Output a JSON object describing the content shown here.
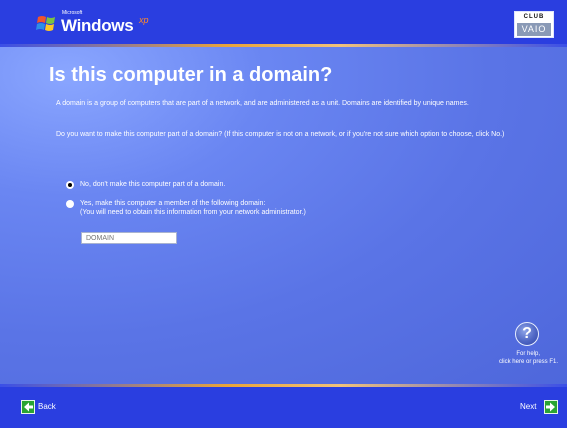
{
  "header": {
    "logo_small": "Microsoft",
    "logo_word": "Windows",
    "logo_xp": "xp",
    "club_top": "CLUB",
    "club_bottom": "VAIO"
  },
  "page": {
    "title": "Is this computer in a domain?",
    "paragraph1": "A domain is a group of computers that are part of a network, and are administered as a unit. Domains are identified by unique names.",
    "paragraph2": "Do you want to make this computer part of a domain? (If this computer is not on a network, or if you're not sure which option to choose, click No.)"
  },
  "options": {
    "no": {
      "label": "No, don't make this computer part of a domain.",
      "selected": true
    },
    "yes": {
      "label": "Yes, make this computer a member of the following domain:",
      "note": "(You will need to obtain this information from your network administrator.)",
      "selected": false
    }
  },
  "domain_field": {
    "placeholder": "DOMAIN"
  },
  "help": {
    "icon": "help-icon",
    "line1": "For help,",
    "line2": "click here or press F1."
  },
  "footer": {
    "back_label": "Back",
    "next_label": "Next"
  },
  "colors": {
    "bar_blue": "#2a3ee0",
    "panel_blue": "#5a74e6",
    "accent_orange": "#e9a43a",
    "nav_green": "#2aa432"
  }
}
